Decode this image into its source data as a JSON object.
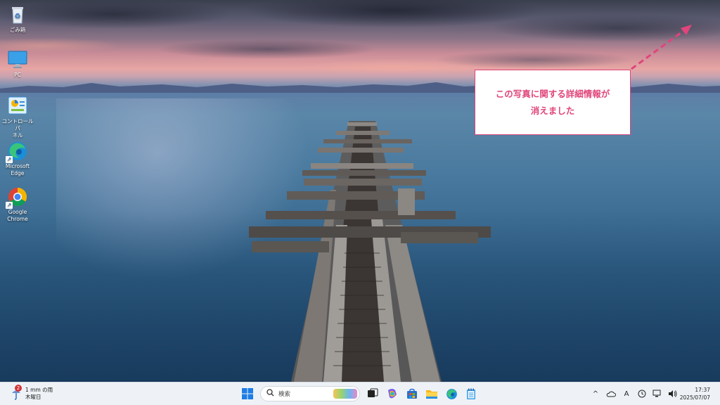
{
  "desktop": {
    "icons": [
      {
        "label": "ごみ箱",
        "icon": "recycle-bin-icon"
      },
      {
        "label": "PC",
        "icon": "monitor-icon"
      },
      {
        "label": "コントロール パ\nネル",
        "icon": "control-panel-icon"
      },
      {
        "label": "Microsoft\nEdge",
        "icon": "edge-icon"
      },
      {
        "label": "Google\nChrome",
        "icon": "chrome-icon"
      }
    ]
  },
  "callout": {
    "line1": "この写真に関する詳細情報が",
    "line2": "消えました",
    "color": "#e0457b"
  },
  "taskbar": {
    "weather": {
      "badge": "2",
      "line1": "1 mm の雨",
      "line2": "木曜日"
    },
    "search_placeholder": "検索",
    "apps": [
      "start-icon",
      "search-icon",
      "task-view-icon",
      "copilot-icon",
      "store-icon",
      "file-explorer-icon",
      "edge-icon",
      "notepad-icon"
    ],
    "tray": {
      "chevron": "^",
      "ime": "A"
    },
    "clock": {
      "time": "17:37",
      "date": "2025/07/07"
    }
  }
}
